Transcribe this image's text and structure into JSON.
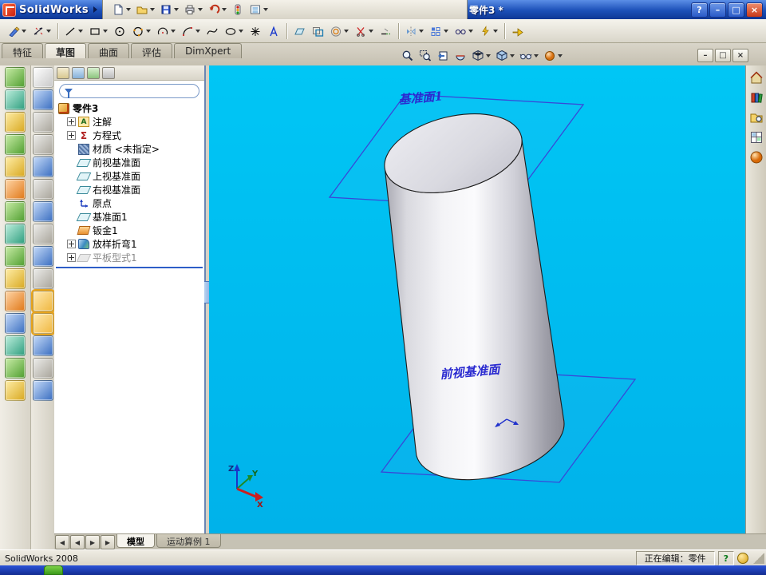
{
  "titlebar": {
    "app_name": "SolidWorks",
    "doc_title": "零件3 *"
  },
  "window_controls": {
    "help": "?",
    "minimize": "–",
    "maximize": "□",
    "close": "×"
  },
  "main_toolbar": {
    "icons": [
      "new",
      "open",
      "save",
      "print",
      "undo",
      "rebuild",
      "options"
    ]
  },
  "sketch_toolbar": {
    "icons": [
      "sketch",
      "smart-dimension",
      "line",
      "corner-rectangle",
      "circle",
      "perimeter-circle",
      "centerpoint-arc",
      "tangent-arc",
      "spline",
      "ellipse",
      "point",
      "text",
      "plane",
      "convert-entities",
      "offset-entities",
      "trim-entities",
      "extend-entities",
      "mirror-entities",
      "linear-sketch-pattern",
      "display-delete-relations",
      "quick-snaps",
      "instant3d"
    ]
  },
  "command_tabs": {
    "active": "草图",
    "items": [
      {
        "label": "特征"
      },
      {
        "label": "草图"
      },
      {
        "label": "曲面"
      },
      {
        "label": "评估"
      },
      {
        "label": "DimXpert"
      }
    ]
  },
  "left_toolbar_sheetmetal": {
    "icons": [
      "base-flange",
      "convert-to-sheet-metal",
      "lofted-bend",
      "edge-flange",
      "miter-flange",
      "hem",
      "jog",
      "sketched-bend",
      "closed-corner",
      "break-corner",
      "forming-tool",
      "extruded-cut",
      "simple-hole",
      "unfold",
      "fold"
    ]
  },
  "left_toolbar_view": {
    "icons": [
      "select",
      "previous-view",
      "zoom-to-fit",
      "zoom-to-area",
      "zoom-in-out",
      "rotate-view",
      "pan",
      "standard-views",
      "wireframe",
      "hidden-lines-visible",
      "shaded-with-edges",
      "shaded",
      "section-view",
      "shadows-in-shaded",
      "camera-view"
    ]
  },
  "tree_header": {
    "icons": [
      "featuremanager",
      "propertymanager",
      "configurationmanager",
      "dimxpertmanager"
    ]
  },
  "feature_tree": {
    "root": "零件3",
    "items": [
      {
        "label": "注解",
        "expandable": true
      },
      {
        "label": "方程式",
        "expandable": true
      },
      {
        "label": "材质 <未指定>",
        "expandable": false
      },
      {
        "label": "前视基准面",
        "expandable": false
      },
      {
        "label": "上视基准面",
        "expandable": false
      },
      {
        "label": "右视基准面",
        "expandable": false
      },
      {
        "label": "原点",
        "expandable": false
      },
      {
        "label": "基准面1",
        "expandable": false
      },
      {
        "label": "钣金1",
        "expandable": false
      },
      {
        "label": "放样折弯1",
        "expandable": true
      },
      {
        "label": "平板型式1",
        "expandable": true,
        "grayed": true
      }
    ]
  },
  "viewport": {
    "plane1_label": "基准面1",
    "front_plane_label": "前视基准面",
    "triad": {
      "x": "X",
      "y": "Y",
      "z": "Z"
    },
    "heads_up_icons": [
      "zoom-to-fit",
      "zoom-to-area",
      "previous-view",
      "section-view",
      "view-orientation",
      "display-style",
      "hide-show-items",
      "appearances"
    ]
  },
  "task_pane": {
    "icons": [
      "solidworks-resources",
      "design-library",
      "file-explorer",
      "view-palette",
      "appearances"
    ]
  },
  "bottom_tabs": {
    "active": "模型",
    "nav": [
      "◀",
      "◀",
      "▶",
      "▶"
    ],
    "items": [
      {
        "label": "模型"
      },
      {
        "label": "运动算例 1"
      }
    ]
  },
  "statusbar": {
    "app_version": "SolidWorks 2008",
    "editing_status": "正在编辑：零件",
    "help_badge": "?"
  }
}
